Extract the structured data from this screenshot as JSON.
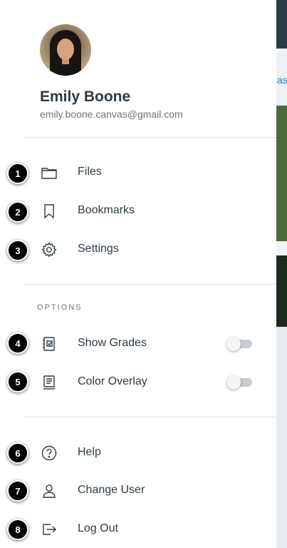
{
  "user": {
    "name": "Emily Boone",
    "email": "emily.boone.canvas@gmail.com"
  },
  "menu": [
    {
      "label": "Files",
      "icon": "folder-icon",
      "badge": "1"
    },
    {
      "label": "Bookmarks",
      "icon": "bookmark-icon",
      "badge": "2"
    },
    {
      "label": "Settings",
      "icon": "gear-icon",
      "badge": "3"
    }
  ],
  "options": {
    "section_label": "OPTIONS",
    "items": [
      {
        "label": "Show Grades",
        "icon": "grades-icon",
        "badge": "4",
        "enabled": false
      },
      {
        "label": "Color Overlay",
        "icon": "color-overlay-icon",
        "badge": "5",
        "enabled": false
      }
    ]
  },
  "footer": [
    {
      "label": "Help",
      "icon": "help-icon",
      "badge": "6"
    },
    {
      "label": "Change User",
      "icon": "change-user-icon",
      "badge": "7"
    },
    {
      "label": "Log Out",
      "icon": "logout-icon",
      "badge": "8"
    }
  ],
  "background_peek": {
    "text": "as"
  },
  "colors": {
    "text": "#2d3b45",
    "muted": "#6b7780",
    "divider": "#dde2e6",
    "badge": "#000000"
  }
}
